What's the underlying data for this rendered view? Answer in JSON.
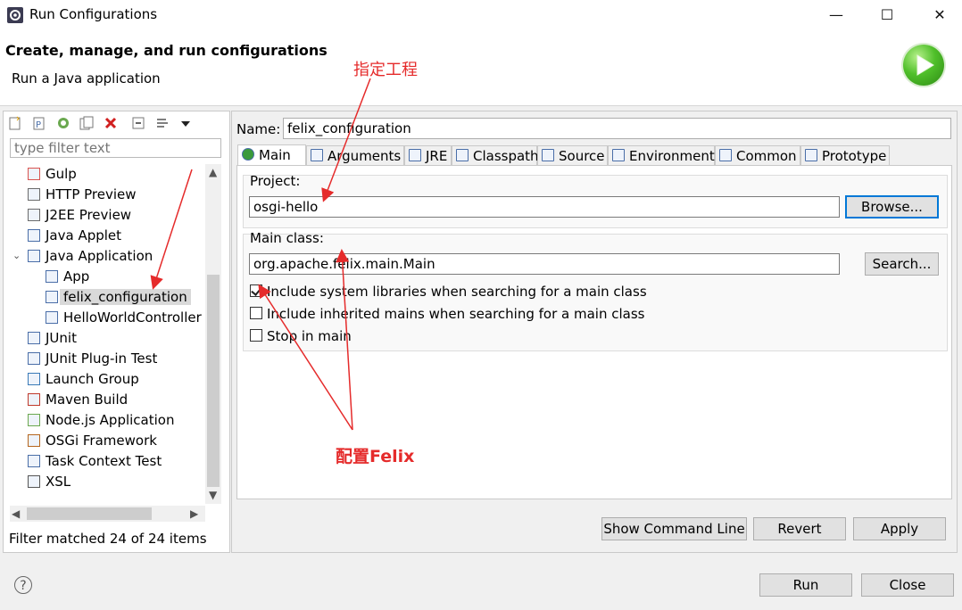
{
  "window": {
    "title": "Run Configurations",
    "minimize": "—",
    "maximize": "☐",
    "close": "✕"
  },
  "header": {
    "title": "Create, manage, and run configurations",
    "subtitle": "Run a Java application"
  },
  "left": {
    "filter_placeholder": "type filter text",
    "tree": [
      {
        "label": "Gulp",
        "icon": "gulp-icon",
        "color": "#d9534f"
      },
      {
        "label": "HTTP Preview",
        "icon": "http-preview-icon",
        "color": "#6b6b6b"
      },
      {
        "label": "J2EE Preview",
        "icon": "j2ee-preview-icon",
        "color": "#6b6b6b"
      },
      {
        "label": "Java Applet",
        "icon": "java-applet-icon",
        "color": "#4a6ea8"
      },
      {
        "label": "Java Application",
        "icon": "java-application-icon",
        "color": "#4a6ea8"
      },
      {
        "label": "App",
        "icon": "java-class-icon",
        "color": "#4a6ea8"
      },
      {
        "label": "felix_configuration",
        "icon": "java-class-icon",
        "color": "#4a6ea8"
      },
      {
        "label": "HelloWorldController",
        "icon": "java-class-icon",
        "color": "#4a6ea8"
      },
      {
        "label": "JUnit",
        "icon": "junit-icon",
        "color": "#4a6ea8"
      },
      {
        "label": "JUnit Plug-in Test",
        "icon": "junit-plugin-icon",
        "color": "#4a6ea8"
      },
      {
        "label": "Launch Group",
        "icon": "launch-group-icon",
        "color": "#3a7ab8"
      },
      {
        "label": "Maven Build",
        "icon": "maven-icon",
        "color": "#c0392b"
      },
      {
        "label": "Node.js Application",
        "icon": "nodejs-icon",
        "color": "#6aa84f"
      },
      {
        "label": "OSGi Framework",
        "icon": "osgi-icon",
        "color": "#b5651d"
      },
      {
        "label": "Task Context Test",
        "icon": "task-context-icon",
        "color": "#4a6ea8"
      },
      {
        "label": "XSL",
        "icon": "xsl-icon",
        "color": "#555555"
      }
    ],
    "status": "Filter matched 24 of 24 items"
  },
  "right": {
    "name_label": "Name:",
    "name_value": "felix_configuration",
    "tabs": [
      {
        "label": "Main",
        "icon": "main-tab-icon"
      },
      {
        "label": "Arguments",
        "icon": "arguments-tab-icon"
      },
      {
        "label": "JRE",
        "icon": "jre-tab-icon"
      },
      {
        "label": "Classpath",
        "icon": "classpath-tab-icon"
      },
      {
        "label": "Source",
        "icon": "source-tab-icon"
      },
      {
        "label": "Environment",
        "icon": "environment-tab-icon"
      },
      {
        "label": "Common",
        "icon": "common-tab-icon"
      },
      {
        "label": "Prototype",
        "icon": "prototype-tab-icon"
      }
    ],
    "project_label": "Project:",
    "project_value": "osgi-hello",
    "browse": "Browse...",
    "main_class_label": "Main class:",
    "main_class_value": "org.apache.felix.main.Main",
    "search": "Search...",
    "checks": [
      {
        "label": "Include system libraries when searching for a main class",
        "checked": true
      },
      {
        "label": "Include inherited mains when searching for a main class",
        "checked": false
      },
      {
        "label": "Stop in main",
        "checked": false
      }
    ],
    "show_command_line": "Show Command Line",
    "revert": "Revert",
    "apply": "Apply"
  },
  "footer": {
    "help": "?",
    "run": "Run",
    "close": "Close"
  },
  "annotations": {
    "project_note": "指定工程",
    "felix_note": "配置Felix",
    "color": "#e52b2b"
  }
}
